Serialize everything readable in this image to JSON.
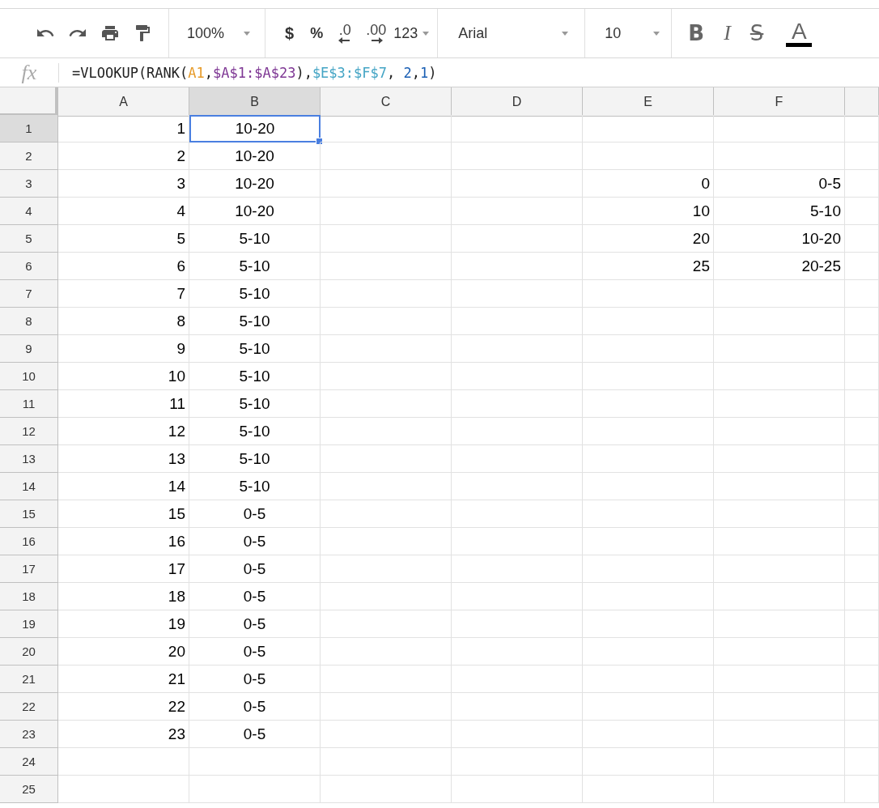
{
  "toolbar": {
    "zoom": "100%",
    "currency": "$",
    "percent": "%",
    "decrease_decimals": ".0",
    "increase_decimals": ".00",
    "number_format": "123",
    "font": "Arial",
    "font_size": "10",
    "bold": "B",
    "italic": "I",
    "strikethrough": "S",
    "text_color": "A"
  },
  "formula_bar": {
    "label": "fx",
    "segments": [
      {
        "text": "=VLOOKUP(RANK(",
        "color": "#222222"
      },
      {
        "text": "A1",
        "color": "#e69a28"
      },
      {
        "text": ",",
        "color": "#222222"
      },
      {
        "text": "$A$1:$A$23",
        "color": "#7e3794"
      },
      {
        "text": "),",
        "color": "#222222"
      },
      {
        "text": "$E$3:$F$7",
        "color": "#45a5c5"
      },
      {
        "text": ", ",
        "color": "#222222"
      },
      {
        "text": "2",
        "color": "#1a5fb4"
      },
      {
        "text": ",",
        "color": "#222222"
      },
      {
        "text": "1",
        "color": "#1a5fb4"
      },
      {
        "text": ")",
        "color": "#222222"
      }
    ]
  },
  "columns": [
    {
      "label": "A",
      "selected": false
    },
    {
      "label": "B",
      "selected": true
    },
    {
      "label": "C",
      "selected": false
    },
    {
      "label": "D",
      "selected": false
    },
    {
      "label": "E",
      "selected": false
    },
    {
      "label": "F",
      "selected": false
    }
  ],
  "rows": [
    {
      "label": "1",
      "selected": true,
      "a": "1",
      "b": "10-20"
    },
    {
      "label": "2",
      "selected": false,
      "a": "2",
      "b": "10-20"
    },
    {
      "label": "3",
      "selected": false,
      "a": "3",
      "b": "10-20",
      "e": "0",
      "f": "0-5"
    },
    {
      "label": "4",
      "selected": false,
      "a": "4",
      "b": "10-20",
      "e": "10",
      "f": "5-10"
    },
    {
      "label": "5",
      "selected": false,
      "a": "5",
      "b": "5-10",
      "e": "20",
      "f": "10-20"
    },
    {
      "label": "6",
      "selected": false,
      "a": "6",
      "b": "5-10",
      "e": "25",
      "f": "20-25"
    },
    {
      "label": "7",
      "selected": false,
      "a": "7",
      "b": "5-10"
    },
    {
      "label": "8",
      "selected": false,
      "a": "8",
      "b": "5-10"
    },
    {
      "label": "9",
      "selected": false,
      "a": "9",
      "b": "5-10"
    },
    {
      "label": "10",
      "selected": false,
      "a": "10",
      "b": "5-10"
    },
    {
      "label": "11",
      "selected": false,
      "a": "11",
      "b": "5-10"
    },
    {
      "label": "12",
      "selected": false,
      "a": "12",
      "b": "5-10"
    },
    {
      "label": "13",
      "selected": false,
      "a": "13",
      "b": "5-10"
    },
    {
      "label": "14",
      "selected": false,
      "a": "14",
      "b": "5-10"
    },
    {
      "label": "15",
      "selected": false,
      "a": "15",
      "b": "0-5"
    },
    {
      "label": "16",
      "selected": false,
      "a": "16",
      "b": "0-5"
    },
    {
      "label": "17",
      "selected": false,
      "a": "17",
      "b": "0-5"
    },
    {
      "label": "18",
      "selected": false,
      "a": "18",
      "b": "0-5"
    },
    {
      "label": "19",
      "selected": false,
      "a": "19",
      "b": "0-5"
    },
    {
      "label": "20",
      "selected": false,
      "a": "20",
      "b": "0-5"
    },
    {
      "label": "21",
      "selected": false,
      "a": "21",
      "b": "0-5"
    },
    {
      "label": "22",
      "selected": false,
      "a": "22",
      "b": "0-5"
    },
    {
      "label": "23",
      "selected": false,
      "a": "23",
      "b": "0-5"
    },
    {
      "label": "24",
      "selected": false
    },
    {
      "label": "25",
      "selected": false
    }
  ]
}
